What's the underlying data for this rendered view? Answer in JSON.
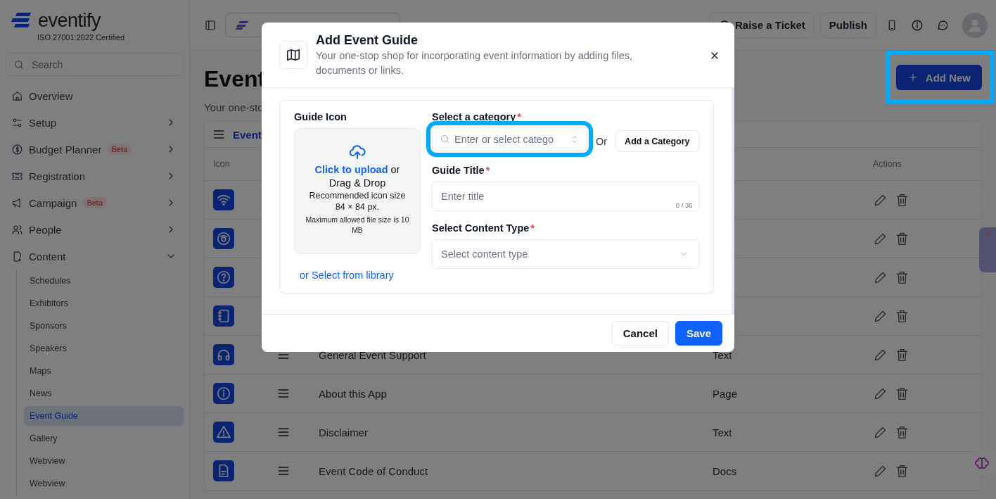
{
  "sidebar": {
    "logo": "eventify",
    "certification": "ISO 27001:2022 Certified",
    "search": {
      "placeholder": "Search"
    },
    "items": [
      {
        "label": "Overview"
      },
      {
        "label": "Setup",
        "expanded": false
      },
      {
        "label": "Budget Planner",
        "badge": "Beta",
        "expanded": false
      },
      {
        "label": "Registration",
        "expanded": false
      },
      {
        "label": "Campaign",
        "badge": "Beta",
        "expanded": false
      },
      {
        "label": "People",
        "expanded": false
      },
      {
        "label": "Content",
        "expanded": true,
        "children": [
          {
            "label": "Schedules",
            "selected": false
          },
          {
            "label": "Exhibitors",
            "selected": false
          },
          {
            "label": "Sponsors",
            "selected": false
          },
          {
            "label": "Speakers",
            "selected": false
          },
          {
            "label": "Maps",
            "selected": false
          },
          {
            "label": "News",
            "selected": false
          },
          {
            "label": "Event Guide",
            "selected": true
          },
          {
            "label": "Gallery",
            "selected": false
          },
          {
            "label": "Webview",
            "selected": false
          },
          {
            "label": "Webview",
            "selected": false
          }
        ]
      }
    ]
  },
  "topbar": {
    "buttons": [
      "Raise a Ticket",
      "Publish"
    ]
  },
  "page": {
    "title": "Event",
    "subtitle": "Your one-sto",
    "add_button": {
      "label": "Add New",
      "highlighted": true
    },
    "table": {
      "tab_label": "Event",
      "columns": [
        "Icon",
        "Actions"
      ],
      "rows": [
        {},
        {},
        {},
        {},
        {
          "title": "General Event Support",
          "type": "Text"
        },
        {
          "title": "About this App",
          "type": "Page"
        },
        {
          "title": "Disclaimer",
          "type": "Text"
        },
        {
          "title": "Event Code of Conduct",
          "type": "Docs"
        }
      ]
    }
  },
  "modal": {
    "title": "Add Event Guide",
    "subtitle": "Your one-stop shop for incorporating event information by adding files, documents or links.",
    "guide_icon": {
      "label": "Guide Icon",
      "upload_link": "Click to upload",
      "upload_text": "or",
      "drag_text": "Drag & Drop",
      "hint": "Recommended icon size 84 × 84 px.",
      "limit": "Maximum allowed file size is 10 MB",
      "library_link": "or Select from library"
    },
    "category": {
      "label": "Select a category",
      "required": true,
      "required_mark": "*",
      "placeholder": "Enter or select catego",
      "highlighted": true,
      "or_text": "Or",
      "add_button": "Add a Category"
    },
    "guide_title": {
      "label": "Guide Title",
      "required": true,
      "required_mark": "*",
      "placeholder": "Enter title",
      "counter": "0 / 35"
    },
    "content_type": {
      "label": "Select Content Type",
      "required": true,
      "required_mark": "*",
      "placeholder": "Select content type"
    },
    "buttons": [
      {
        "label": "Cancel",
        "kind": "secondary"
      },
      {
        "label": "Save",
        "kind": "primary"
      }
    ]
  }
}
